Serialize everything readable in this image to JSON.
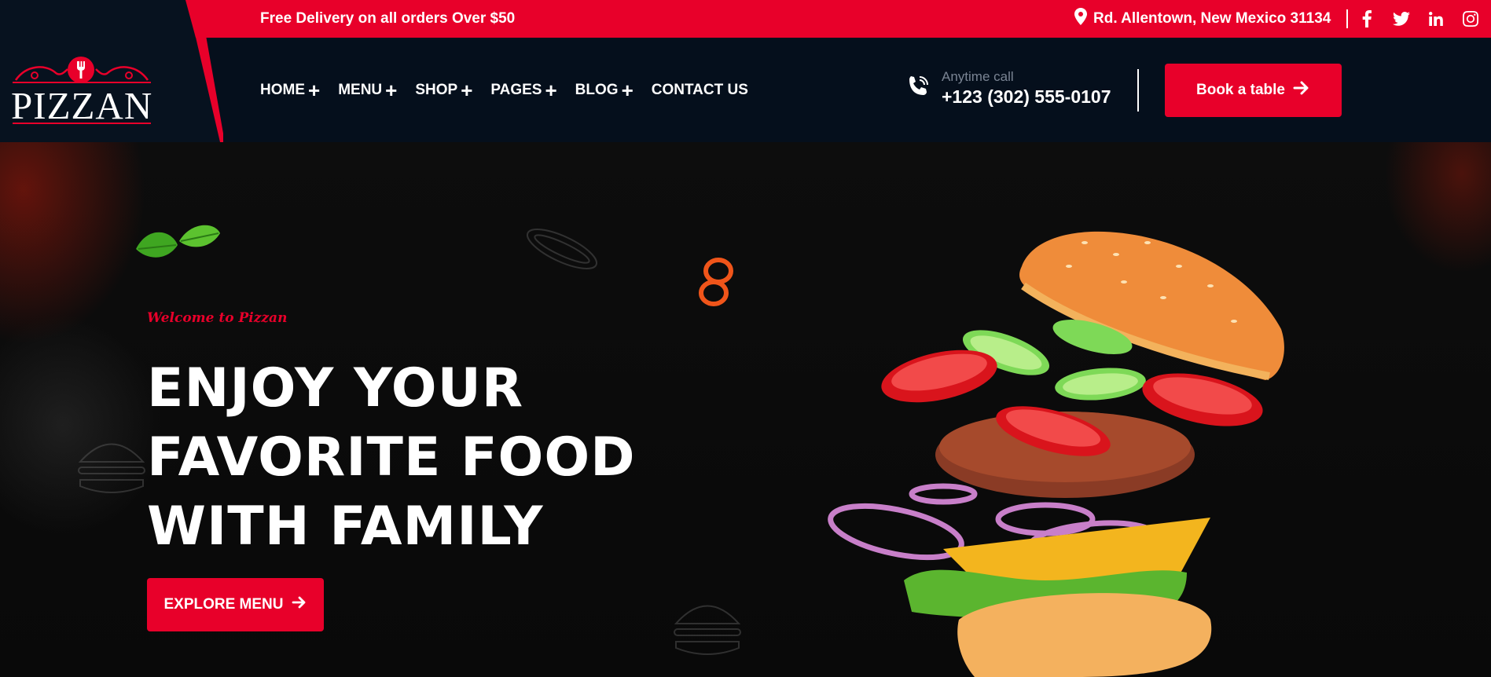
{
  "topbar": {
    "promo": "Free Delivery on all orders Over $50",
    "address": "Rd. Allentown, New Mexico 31134",
    "address_icon": "map-pin-icon",
    "socials": [
      "facebook-icon",
      "twitter-icon",
      "linkedin-icon",
      "instagram-icon"
    ]
  },
  "brand": {
    "name": "PIZZAN",
    "logo_icon": "fork-icon"
  },
  "nav": {
    "items": [
      {
        "label": "HOME",
        "has_submenu": true
      },
      {
        "label": "MENU",
        "has_submenu": true
      },
      {
        "label": "SHOP",
        "has_submenu": true
      },
      {
        "label": "PAGES",
        "has_submenu": true
      },
      {
        "label": "BLOG",
        "has_submenu": true
      },
      {
        "label": "CONTACT US",
        "has_submenu": false
      }
    ],
    "submenu_glyph": "+"
  },
  "call": {
    "label": "Anytime call",
    "number": "+123 (302) 555-0107",
    "icon": "phone-icon"
  },
  "book_button": {
    "label": "Book a table",
    "icon": "arrow-right-icon"
  },
  "hero": {
    "eyebrow": "Welcome to Pizzan",
    "headline_lines": [
      "ENJOY YOUR",
      "FAVORITE FOOD",
      "WITH FAMILY"
    ],
    "cta": "EXPLORE MENU",
    "cta_icon": "arrow-right-icon"
  },
  "colors": {
    "accent": "#e8002a",
    "header_bg": "#050f1c",
    "hero_bg": "#0b0b0b"
  }
}
